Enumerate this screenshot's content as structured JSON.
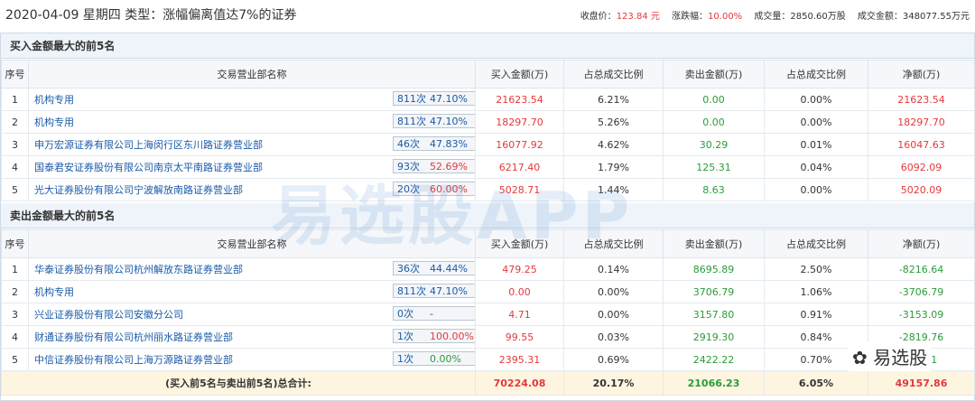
{
  "header": {
    "title": "2020-04-09 星期四 类型：涨幅偏离值达7%的证券",
    "close_label": "收盘价：",
    "close_value": "123.84 元",
    "change_label": "涨跌幅：",
    "change_value": "10.00%",
    "volume_label": "成交量：",
    "volume_value": "2850.60万股",
    "amount_label": "成交金额：",
    "amount_value": "348077.55万元"
  },
  "buy": {
    "section_title": "买入金额最大的前5名",
    "columns": [
      "序号",
      "交易营业部名称",
      "买入金额(万)",
      "占总成交比例",
      "卖出金额(万)",
      "占总成交比例",
      "净额(万)"
    ],
    "rows": [
      {
        "idx": "1",
        "name": "机构专用",
        "count": "811次",
        "pct": "47.10%",
        "buy": "21623.54",
        "buy_ratio": "6.21%",
        "sell": "0.00",
        "sell_ratio": "0.00%",
        "net": "21623.54"
      },
      {
        "idx": "2",
        "name": "机构专用",
        "count": "811次",
        "pct": "47.10%",
        "buy": "18297.70",
        "buy_ratio": "5.26%",
        "sell": "0.00",
        "sell_ratio": "0.00%",
        "net": "18297.70"
      },
      {
        "idx": "3",
        "name": "申万宏源证券有限公司上海闵行区东川路证券营业部",
        "count": "46次",
        "pct": "47.83%",
        "buy": "16077.92",
        "buy_ratio": "4.62%",
        "sell": "30.29",
        "sell_ratio": "0.01%",
        "net": "16047.63"
      },
      {
        "idx": "4",
        "name": "国泰君安证券股份有限公司南京太平南路证券营业部",
        "count": "93次",
        "pct": "52.69%",
        "buy": "6217.40",
        "buy_ratio": "1.79%",
        "sell": "125.31",
        "sell_ratio": "0.04%",
        "net": "6092.09"
      },
      {
        "idx": "5",
        "name": "光大证券股份有限公司宁波解放南路证券营业部",
        "count": "20次",
        "pct": "60.00%",
        "buy": "5028.71",
        "buy_ratio": "1.44%",
        "sell": "8.63",
        "sell_ratio": "0.00%",
        "net": "5020.09"
      }
    ]
  },
  "sell": {
    "section_title": "卖出金额最大的前5名",
    "columns": [
      "序号",
      "交易营业部名称",
      "买入金额(万)",
      "占总成交比例",
      "卖出金额(万)",
      "占总成交比例",
      "净额(万)"
    ],
    "rows": [
      {
        "idx": "1",
        "name": "华泰证券股份有限公司杭州解放东路证券营业部",
        "count": "36次",
        "pct": "44.44%",
        "buy": "479.25",
        "buy_ratio": "0.14%",
        "sell": "8695.89",
        "sell_ratio": "2.50%",
        "net": "-8216.64"
      },
      {
        "idx": "2",
        "name": "机构专用",
        "count": "811次",
        "pct": "47.10%",
        "buy": "0.00",
        "buy_ratio": "0.00%",
        "sell": "3706.79",
        "sell_ratio": "1.06%",
        "net": "-3706.79"
      },
      {
        "idx": "3",
        "name": "兴业证券股份有限公司安徽分公司",
        "count": "0次",
        "pct": "-",
        "buy": "4.71",
        "buy_ratio": "0.00%",
        "sell": "3157.80",
        "sell_ratio": "0.91%",
        "net": "-3153.09"
      },
      {
        "idx": "4",
        "name": "财通证券股份有限公司杭州丽水路证券营业部",
        "count": "1次",
        "pct": "100.00%",
        "buy": "99.55",
        "buy_ratio": "0.03%",
        "sell": "2919.30",
        "sell_ratio": "0.84%",
        "net": "-2819.76"
      },
      {
        "idx": "5",
        "name": "中信证券股份有限公司上海万源路证券营业部",
        "count": "1次",
        "pct": "0.00%",
        "buy": "2395.31",
        "buy_ratio": "0.69%",
        "sell": "2422.22",
        "sell_ratio": "0.70%",
        "net": "-26.91"
      }
    ],
    "total": {
      "label": "(买入前5名与卖出前5名)总合计:",
      "buy": "70224.08",
      "buy_ratio": "20.17%",
      "sell": "21066.23",
      "sell_ratio": "6.05%",
      "net": "49157.86"
    }
  },
  "watermark": "易选股APP",
  "logo": "易选股"
}
